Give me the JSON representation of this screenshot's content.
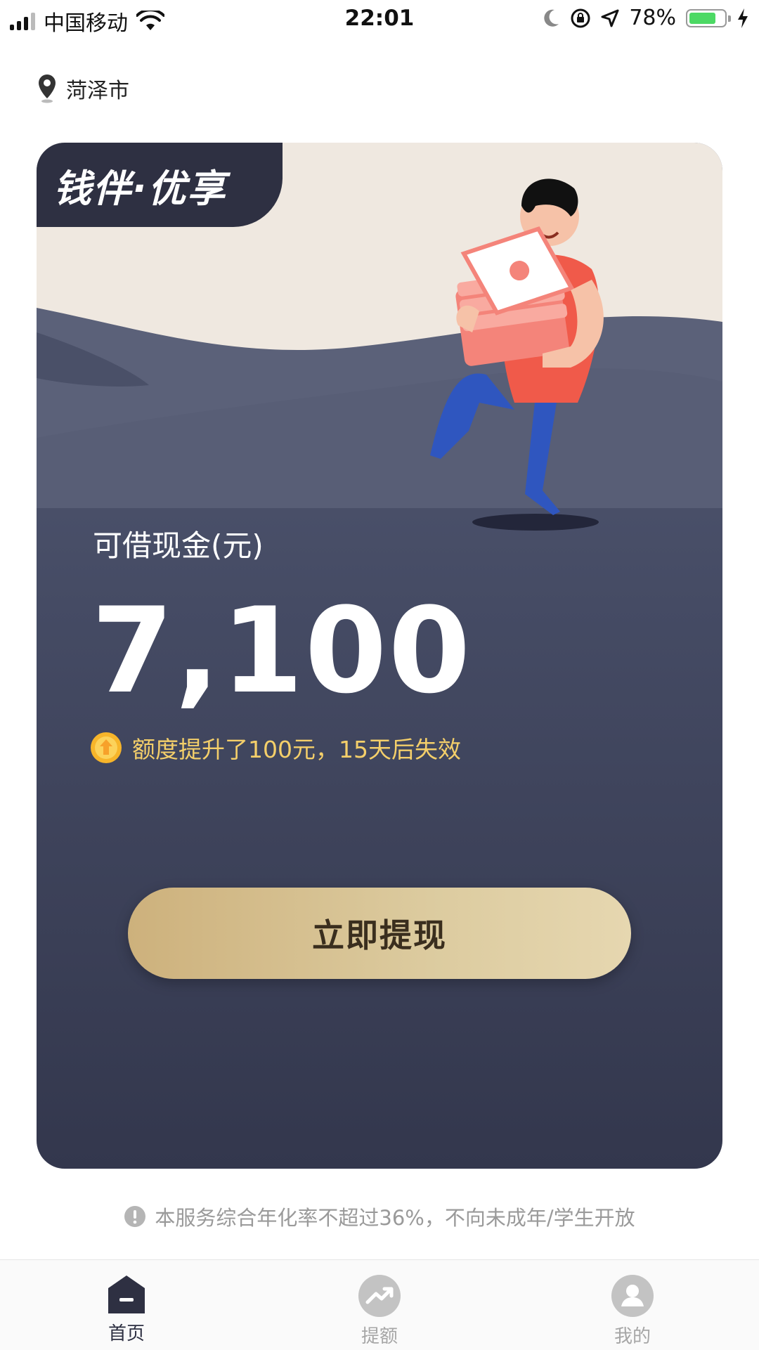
{
  "status_bar": {
    "carrier": "中国移动",
    "time": "22:01",
    "battery_percent": "78%",
    "battery_level": 0.78
  },
  "location": {
    "city": "菏泽市"
  },
  "card": {
    "brand": "钱伴·优享",
    "cash_label": "可借现金(元)",
    "amount": "7,100",
    "notice": "额度提升了100元，15天后失效",
    "cta_label": "立即提现"
  },
  "disclaimer": "本服务综合年化率不超过36%，不向未成年/学生开放",
  "tabs": [
    {
      "label": "首页",
      "icon": "home-icon",
      "active": true
    },
    {
      "label": "提额",
      "icon": "trend-up-icon",
      "active": false
    },
    {
      "label": "我的",
      "icon": "profile-icon",
      "active": false
    }
  ],
  "colors": {
    "accent_gold": "#d8c08e",
    "notice_yellow": "#f4cf6a",
    "card_dark": "#3a3f56",
    "tab_active": "#2e3042",
    "tab_inactive": "#a6a6a6"
  }
}
